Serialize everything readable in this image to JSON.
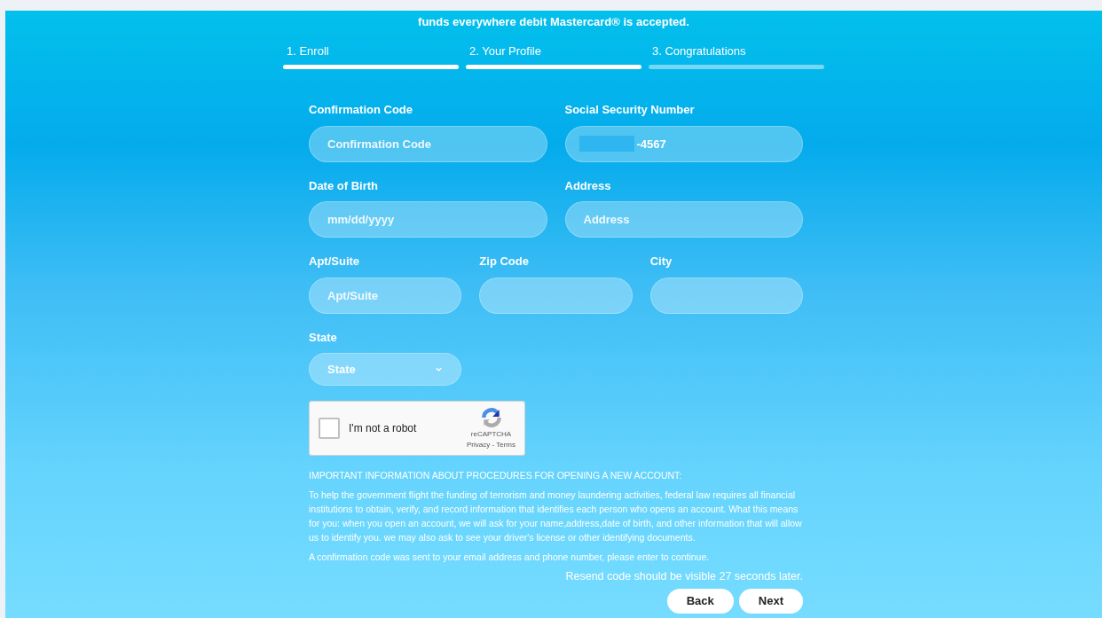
{
  "intro": "funds everywhere debit Mastercard® is accepted.",
  "steps": [
    {
      "label": "1. Enroll",
      "completed": true
    },
    {
      "label": "2. Your Profile",
      "completed": true
    },
    {
      "label": "3. Congratulations",
      "completed": false
    }
  ],
  "form_rows": [
    {
      "fields": [
        {
          "label": "Confirmation Code",
          "placeholder": "Confirmation Code",
          "kind": "text"
        },
        {
          "label": "Social Security Number",
          "value": "-4567",
          "redacted": true,
          "kind": "text"
        }
      ]
    },
    {
      "fields": [
        {
          "label": "Date of Birth",
          "placeholder": "mm/dd/yyyy",
          "kind": "text"
        },
        {
          "label": "Address",
          "placeholder": "Address",
          "kind": "text"
        }
      ]
    },
    {
      "fields": [
        {
          "label": "Apt/Suite",
          "placeholder": "Apt/Suite",
          "kind": "text"
        },
        {
          "label": "Zip Code",
          "kind": "text"
        },
        {
          "label": "City",
          "kind": "text"
        }
      ]
    },
    {
      "fields": [
        {
          "label": "State",
          "placeholder": "State",
          "kind": "select"
        }
      ]
    }
  ],
  "captcha": {
    "label": "I'm not a robot",
    "checked": false,
    "brand": "reCAPTCHA",
    "links": "Privacy - Terms"
  },
  "notice_title": "IMPORTANT INFORMATION ABOUT PROCEDURES FOR OPENING A NEW ACCOUNT:",
  "notice_text": "To help the government flight the funding of terrorism and money laundering activities, federal law requires all financial institutions to obtain, verify, and record information that identifies each person who opens an account. What this means for you: when you open an account, we will ask for your name,address,date of birth, and other information that will allow us to identify you. we may also ask to see your driver's license or other identifying documents.",
  "code_sent_text": "A confirmation code was sent to your email address and phone number, please enter to continue.",
  "resend_text": "Resend code should be visible 27 seconds later.",
  "buttons": [
    "Back",
    "Next"
  ]
}
